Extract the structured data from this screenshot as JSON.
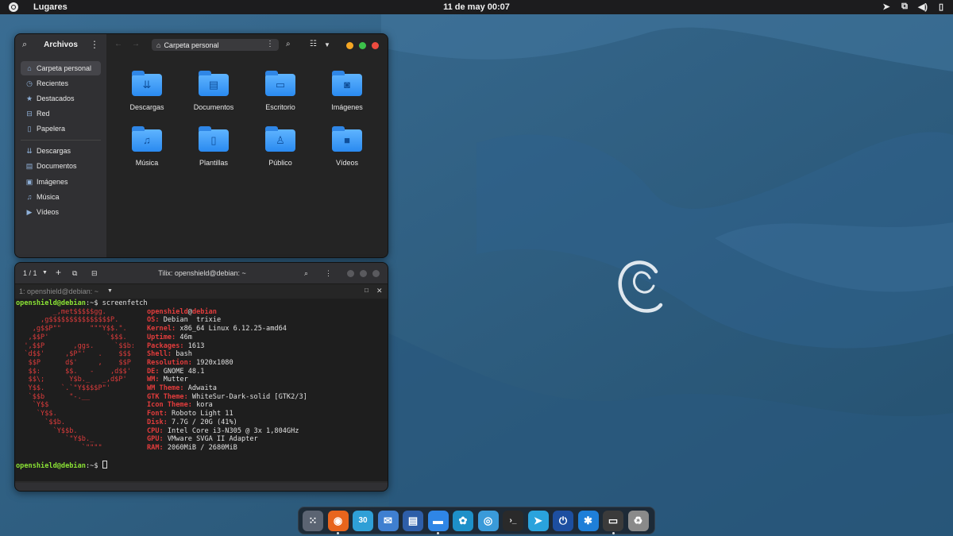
{
  "topbar": {
    "places_label": "Lugares",
    "clock": "11 de may  00:07",
    "tray_icons": [
      "telegram-icon",
      "network-icon",
      "volume-icon",
      "battery-icon"
    ]
  },
  "files": {
    "sidebar_title": "Archivos",
    "path": "Carpeta personal",
    "places": [
      {
        "label": "Carpeta personal",
        "icon": "home-icon",
        "selected": true
      },
      {
        "label": "Recientes",
        "icon": "recent-icon"
      },
      {
        "label": "Destacados",
        "icon": "star-icon"
      },
      {
        "label": "Red",
        "icon": "network-icon"
      },
      {
        "label": "Papelera",
        "icon": "trash-icon"
      },
      {
        "label": "Descargas",
        "icon": "download-icon"
      },
      {
        "label": "Documentos",
        "icon": "document-icon"
      },
      {
        "label": "Imágenes",
        "icon": "image-icon"
      },
      {
        "label": "Música",
        "icon": "music-icon"
      },
      {
        "label": "Vídeos",
        "icon": "video-icon"
      }
    ],
    "folders": [
      {
        "label": "Descargas",
        "icon": "download-folder-icon",
        "glyph": "⇊"
      },
      {
        "label": "Documentos",
        "icon": "documents-folder-icon",
        "glyph": "▤"
      },
      {
        "label": "Escritorio",
        "icon": "desktop-folder-icon",
        "glyph": "▭"
      },
      {
        "label": "Imágenes",
        "icon": "pictures-folder-icon",
        "glyph": "◙"
      },
      {
        "label": "Música",
        "icon": "music-folder-icon",
        "glyph": "♫"
      },
      {
        "label": "Plantillas",
        "icon": "templates-folder-icon",
        "glyph": "▯"
      },
      {
        "label": "Público",
        "icon": "public-folder-icon",
        "glyph": "♙"
      },
      {
        "label": "Vídeos",
        "icon": "videos-folder-icon",
        "glyph": "■"
      }
    ]
  },
  "terminal": {
    "session_counter": "1 / 1",
    "title": "Tilix: openshield@debian: ~",
    "tab_label": "1: openshield@debian: ~",
    "prompt_user": "openshield@debian",
    "prompt_suffix": ":~$ ",
    "command": "screenfetch",
    "ascii_art": [
      "         _,met$$$$$gg.",
      "      ,g$$$$$$$$$$$$$$$P.",
      "    ,g$$P\"\"       \"\"\"Y$$.\".",
      "   ,$$P'              `$$$.",
      "  ',$$P       ,ggs.     `$$b:",
      "  `d$$'     ,$P\"'   .    $$$",
      "   $$P      d$'     ,    $$P",
      "   $$:      $$.   -    ,d$$'",
      "   $$\\;      Y$b._   _,d$P'",
      "   Y$$.    `.`\"Y$$$$P\"'",
      "   `$$b      \"-.__",
      "    `Y$$",
      "     `Y$$.",
      "       `$$b.",
      "         `Y$$b.",
      "            `\"Y$b._",
      "                `\"\"\"\""
    ],
    "info_user": "openshield",
    "info_at": "@",
    "info_host": "debian",
    "info": [
      {
        "key": "OS:",
        "value": "Debian  trixie"
      },
      {
        "key": "Kernel:",
        "value": "x86_64 Linux 6.12.25-amd64"
      },
      {
        "key": "Uptime:",
        "value": "46m"
      },
      {
        "key": "Packages:",
        "value": "1613"
      },
      {
        "key": "Shell:",
        "value": "bash"
      },
      {
        "key": "Resolution:",
        "value": "1920x1080"
      },
      {
        "key": "DE:",
        "value": "GNOME 48.1"
      },
      {
        "key": "WM:",
        "value": "Mutter"
      },
      {
        "key": "WM Theme:",
        "value": "Adwaita"
      },
      {
        "key": "GTK Theme:",
        "value": "WhiteSur-Dark-solid [GTK2/3]"
      },
      {
        "key": "Icon Theme:",
        "value": "kora"
      },
      {
        "key": "Font:",
        "value": "Roboto Light 11"
      },
      {
        "key": "Disk:",
        "value": "7.7G / 20G (41%)"
      },
      {
        "key": "CPU:",
        "value": "Intel Core i3-N305 @ 3x 1,804GHz"
      },
      {
        "key": "GPU:",
        "value": "VMware SVGA II Adapter"
      },
      {
        "key": "RAM:",
        "value": "2060MiB / 2680MiB"
      }
    ]
  },
  "dock": {
    "apps": [
      {
        "name": "app-grid-icon",
        "color": "#5b6472",
        "glyph": "⁙",
        "running": false
      },
      {
        "name": "firefox-icon",
        "color": "#e8651d",
        "glyph": "◉",
        "running": true
      },
      {
        "name": "calendar-icon",
        "color": "#2f9fd6",
        "glyph": "30",
        "running": false
      },
      {
        "name": "mail-icon",
        "color": "#3f7fd0",
        "glyph": "✉",
        "running": false
      },
      {
        "name": "text-editor-icon",
        "color": "#2e5ea8",
        "glyph": "▤",
        "running": false
      },
      {
        "name": "files-icon",
        "color": "#2f86e6",
        "glyph": "▬",
        "running": true
      },
      {
        "name": "gnome-extensions-icon",
        "color": "#1e90c8",
        "glyph": "✿",
        "running": false
      },
      {
        "name": "help-icon",
        "color": "#3a9ad9",
        "glyph": "◎",
        "running": false
      },
      {
        "name": "terminal-icon",
        "color": "#2a2a2a",
        "glyph": "›_",
        "running": false
      },
      {
        "name": "telegram-app-icon",
        "color": "#2aa3dd",
        "glyph": "➤",
        "running": false
      },
      {
        "name": "settings-toggle-icon",
        "color": "#1d4fa0",
        "glyph": "⏻",
        "running": false
      },
      {
        "name": "extension-manager-icon",
        "color": "#1f7fd8",
        "glyph": "✱",
        "running": false
      },
      {
        "name": "tilix-icon",
        "color": "#3b3b3b",
        "glyph": "▭",
        "running": true
      },
      {
        "name": "trash-icon",
        "color": "#8a8a8a",
        "glyph": "♻",
        "running": false
      }
    ]
  },
  "colors": {
    "accent": "#2a8af0",
    "desktop": "#2b5a7e",
    "term_green": "#8ae234",
    "term_blue": "#6a9fd8",
    "term_red": "#d93b3b"
  }
}
